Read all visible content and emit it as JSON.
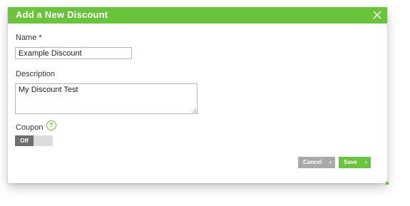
{
  "dialog": {
    "title": "Add a New Discount",
    "close_icon": "close-icon",
    "accent_color": "#6bc23b"
  },
  "form": {
    "name_label": "Name *",
    "name_value": "Example Discount",
    "description_label": "Description",
    "description_value": "My Discount Test",
    "coupon_label": "Coupon",
    "coupon_help_icon": "help-icon",
    "coupon_help_glyph": "?",
    "coupon_toggle_label": "Off",
    "coupon_toggle_state": "off"
  },
  "actions": {
    "cancel_label": "Cancel",
    "save_label": "Save",
    "chevron_icon": "chevron-right-icon",
    "chevron_glyph": "›"
  }
}
